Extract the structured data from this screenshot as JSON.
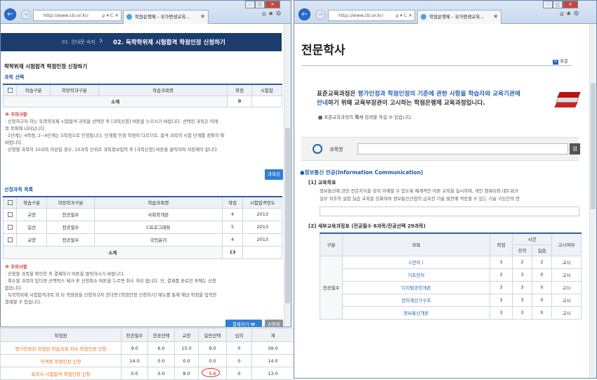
{
  "left_browser": {
    "url": "http://www.cb.or.kr/",
    "addr_controls": "ρ ▾ C ✕",
    "tab_title": "학점은행제 - 국가평생교육...",
    "step1": "01. 안내문 숙지",
    "step2": "02. 독학학위제 시험합격 학점인정 신청하기",
    "page_title": "학학위제 시험합격 학점인정 신청하기",
    "course_section": "과목 선택",
    "table1_headers": [
      "학습구분",
      "희망학과구분",
      "학습과목명",
      "학점",
      "시험합"
    ],
    "table1_total_label": "소계",
    "table1_total_value": "0",
    "notice1_title": "※ 주의사항",
    "notice1_lines": [
      "· 신청하고자 하는 독학학위제 시험합격 과목을 선택한 후 [과목신청] 버튼을 누르시기 바랍니다. 선택된 과목은 아래",
      "  목 목록에 나타납니다.",
      "· 1단계는 4학점, 2~4단계는 5학점으로 인정됩니다. 단계별 인정 학점이 다르므로, 합격 과목의 시험 단계를 정확히 확",
      "  바랍니다.",
      "· 신청할 과목이 10과목 이상일 경우, 10과목 단위로 과목정보입력 후 [과목신청] 버튼을 클릭하여 저장해야 합니다."
    ],
    "apply_button": "과목신",
    "selected_section": "선정과목 목록",
    "table2_headers": [
      "학습구분",
      "희망학과구분",
      "학습과목명",
      "학점",
      "시험합격연도"
    ],
    "table2_rows": [
      {
        "type": "교양",
        "dept": "전공필수",
        "name": "사회학개론",
        "credit": "4",
        "year": "2013"
      },
      {
        "type": "일선",
        "dept": "전공필수",
        "name": "C프로그래밍",
        "credit": "5",
        "year": "2013"
      },
      {
        "type": "교양",
        "dept": "전공필수",
        "name": "국민윤리",
        "credit": "4",
        "year": "2013"
      }
    ],
    "table2_total_label": "소계",
    "table2_total_value": "13",
    "notice2_title": "※ 주의사항",
    "notice2_lines": [
      "· 신청할 과목을 확인한 후 결제하기 버튼을 클릭하시기 바랍니다.",
      "· 취소할 과목이 있다면 선택박스 체크 후 신청취소 버튼을 누르면 취소 처리 됩니다. 단, 결제를 완료한 후에는 신청",
      "  없습니다.",
      "· 독학학위제 시험합격과목 외 타 학점원을 신청하고자 한다면 [학점인정 신청하기] 메뉴를 통해 해당 학점을 입력한",
      "  결제할 수 있습니다."
    ],
    "pay_button": "결제하기  ₩",
    "cancel_button": "신청취"
  },
  "summary": {
    "headers": [
      "학점원",
      "전공필수",
      "전공선택",
      "교양",
      "일반선택",
      "심의",
      "계"
    ],
    "rows": [
      {
        "name": "평가인정된 학점원 학습과목 이수 학점인정 신청",
        "c": [
          "9.0",
          "6.0",
          "15.0",
          "9.0",
          "0",
          "39.0"
        ]
      },
      {
        "name": "자격증 학점인정 신청",
        "c": [
          "14.0",
          "0.0",
          "0.0",
          "0.0",
          "0",
          "14.0"
        ]
      },
      {
        "name": "독학사 시험합격 학점인정 신청",
        "c": [
          "0.0",
          "0.0",
          "8.0",
          "5.0",
          "0",
          "13.0"
        ]
      }
    ]
  },
  "right_browser": {
    "url": "http://www.cb.or.kr/",
    "addr_controls": "ρ ▾ C ✕",
    "tab_title": "학점은행제 - 국가평생교육...",
    "heading": "전문학사",
    "breadcrumb": "표준",
    "intro_line1_a": "표준교육과정은 ",
    "intro_line1_b": "평가인정과 학점인정의 기준에 관한 사항을 학습자와 교육기관에",
    "intro_line2_a": "안내",
    "intro_line2_b": "하기 위해 교육부장관이 고시하는 학점은행제 교육과정입니다.",
    "intro_note_a": "■ 표준교육과정의 ",
    "intro_note_b": "학사",
    "intro_note_c": " 검색을 하실 수 있습니다.",
    "search_label": "과목명",
    "search_button": "검",
    "major_title": "●정보통신 전공(Information Communication)",
    "goal_title": "[1] 교육목표",
    "goal_text1": "정보통신에 관한 전문지식을 갖이 이해할 수 있도록 체계적인 이론 교육을 실시하며, 개인 컴퓨터와 네트워크",
    "goal_text2": "실무 위주의 실험 실습 교육을 강화하여 정보통신산업의 급속한 기술 발전에 적응할 수 있는 기술 기능인의 양",
    "detail_title": "[2] 세부교육과정표 (전공필수 6과목/전공선택 29과목)",
    "table_headers": [
      "구분",
      "과목",
      "학점",
      "시간",
      "고시여부"
    ],
    "time_sub": [
      "강의",
      "실습"
    ],
    "group_label": "전공필수",
    "course_rows": [
      {
        "name": "C언어 I",
        "credit": "3",
        "lec": "2",
        "lab": "2",
        "notice": "고시"
      },
      {
        "name": "기초전자",
        "credit": "3",
        "lec": "3",
        "lab": "0",
        "notice": "고시"
      },
      {
        "name": "디지털공학개론",
        "credit": "3",
        "lec": "3",
        "lab": "0",
        "notice": "고시"
      },
      {
        "name": "전자계산기구조",
        "credit": "3",
        "lec": "3",
        "lab": "0",
        "notice": "고시"
      },
      {
        "name": "정보통신개론",
        "credit": "3",
        "lec": "3",
        "lab": "0",
        "notice": "고시"
      }
    ]
  },
  "colors": {
    "nav": "#1d3c6e",
    "accent": "#2f7fd3",
    "orange": "#e0731f",
    "red_mark": "#d8282a"
  }
}
